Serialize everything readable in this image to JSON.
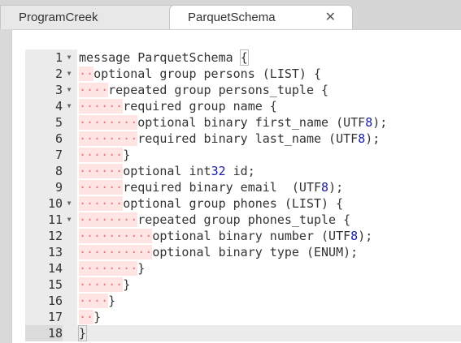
{
  "tabs": [
    {
      "label": "ProgramCreek",
      "active": false
    },
    {
      "label": "ParquetSchema",
      "active": true,
      "close_icon": "close-icon"
    }
  ],
  "editor": {
    "active_line": 18,
    "lines": [
      {
        "n": "1",
        "indent": 0,
        "fold": true,
        "text": "message ParquetSchema {"
      },
      {
        "n": "2",
        "indent": 2,
        "fold": true,
        "text": "optional group persons (LIST) {"
      },
      {
        "n": "3",
        "indent": 4,
        "fold": true,
        "text": "repeated group persons_tuple {"
      },
      {
        "n": "4",
        "indent": 6,
        "fold": true,
        "text": "required group name {"
      },
      {
        "n": "5",
        "indent": 8,
        "fold": false,
        "text": "optional binary first_name (UTF8);"
      },
      {
        "n": "6",
        "indent": 8,
        "fold": false,
        "text": "required binary last_name (UTF8);"
      },
      {
        "n": "7",
        "indent": 6,
        "fold": false,
        "text": "}"
      },
      {
        "n": "8",
        "indent": 6,
        "fold": false,
        "text": "optional int32 id;"
      },
      {
        "n": "9",
        "indent": 6,
        "fold": false,
        "text": "required binary email  (UTF8);"
      },
      {
        "n": "10",
        "indent": 6,
        "fold": true,
        "text": "optional group phones (LIST) {"
      },
      {
        "n": "11",
        "indent": 8,
        "fold": true,
        "text": "repeated group phones_tuple {"
      },
      {
        "n": "12",
        "indent": 10,
        "fold": false,
        "text": "optional binary number (UTF8);"
      },
      {
        "n": "13",
        "indent": 10,
        "fold": false,
        "text": "optional binary type (ENUM);"
      },
      {
        "n": "14",
        "indent": 8,
        "fold": false,
        "text": "}"
      },
      {
        "n": "15",
        "indent": 6,
        "fold": false,
        "text": "}"
      },
      {
        "n": "16",
        "indent": 4,
        "fold": false,
        "text": "}"
      },
      {
        "n": "17",
        "indent": 2,
        "fold": false,
        "text": "}"
      },
      {
        "n": "18",
        "indent": 0,
        "fold": false,
        "text": "}"
      }
    ]
  },
  "colors": {
    "whitespace_bg": "#ffe4e4",
    "whitespace_dot": "#e67a7a",
    "number": "#1a1aa6",
    "gutter_bg": "#ebebeb"
  }
}
